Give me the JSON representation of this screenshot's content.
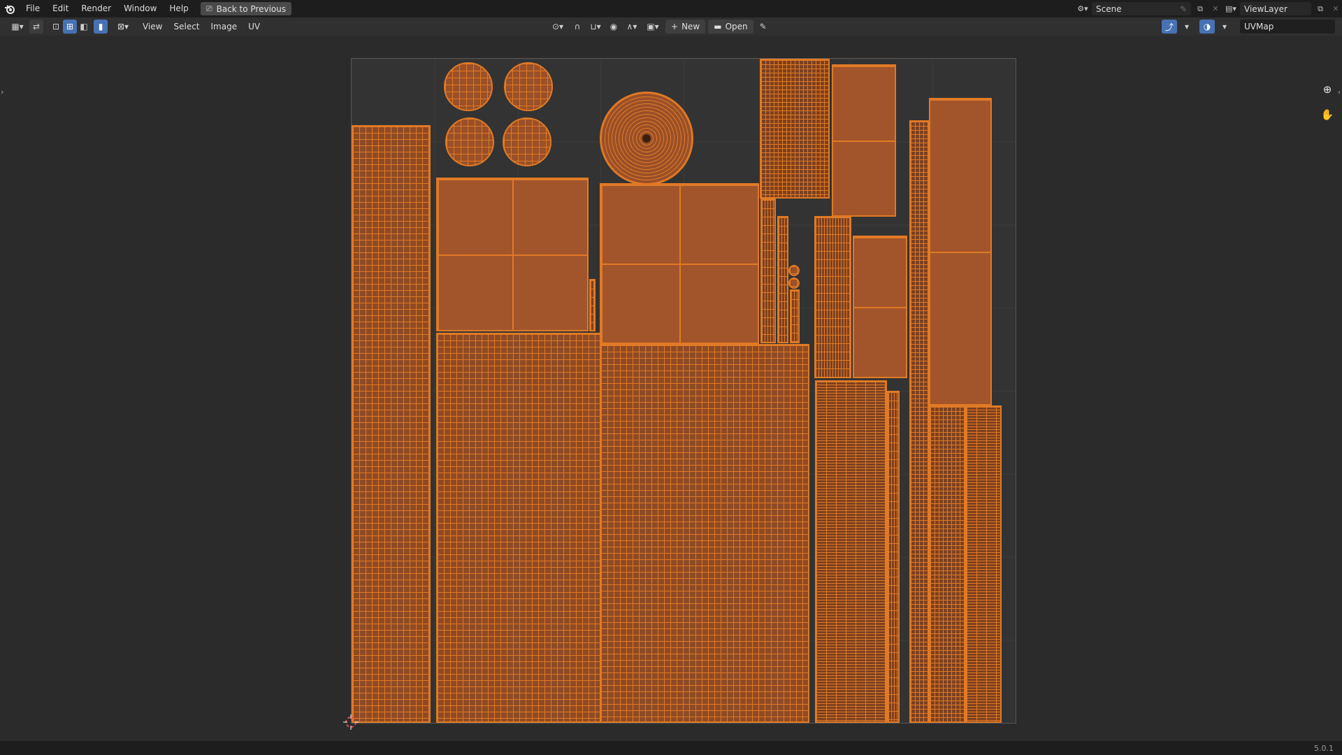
{
  "topbar": {
    "menus": [
      "File",
      "Edit",
      "Render",
      "Window",
      "Help"
    ],
    "back_button": "Back to Previous",
    "scene": "Scene",
    "view_layer": "ViewLayer"
  },
  "header": {
    "menus": [
      "View",
      "Select",
      "Image",
      "UV"
    ],
    "new_label": "New",
    "open_label": "Open",
    "uv_map": "UVMap"
  },
  "statusbar": {
    "version": "5.0.1"
  },
  "icons": {
    "app": "blender-logo-icon",
    "editor_type": "uv-editor-icon",
    "sync": "uv-sync-selection-icon",
    "zoom": "zoom-icon",
    "pan": "hand-pan-icon"
  },
  "colors": {
    "uv_edge": "#e07a25",
    "uv_face": "#a8592d",
    "background": "#2b2b2b"
  }
}
